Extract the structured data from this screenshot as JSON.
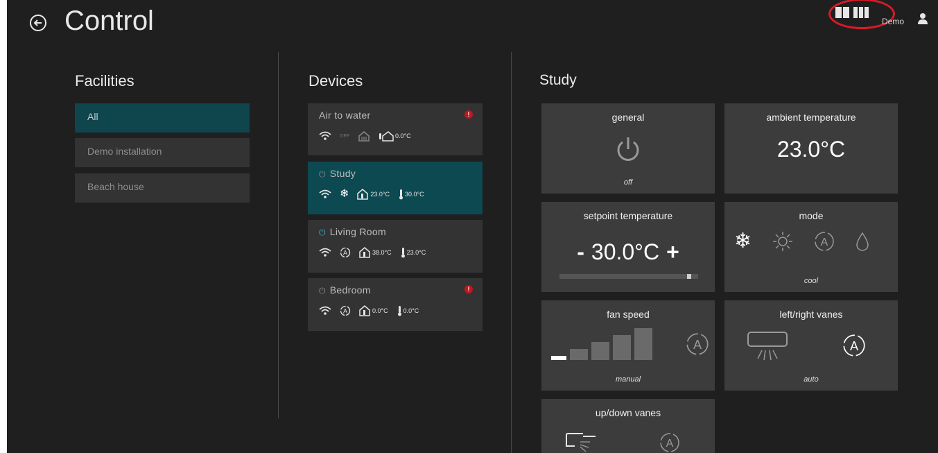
{
  "header": {
    "title": "Control",
    "user_name": "Demo"
  },
  "facilities": {
    "heading": "Facilities",
    "items": [
      {
        "label": "All",
        "active": true
      },
      {
        "label": "Demo installation"
      },
      {
        "label": "Beach house"
      }
    ]
  },
  "devices": {
    "heading": "Devices",
    "items": [
      {
        "name": "Air to water",
        "alert": "!",
        "status": "OFF",
        "outdoor_temp": "0.0°C"
      },
      {
        "name": "Study",
        "ambient": "23.0°C",
        "setpoint": "30.0°C"
      },
      {
        "name": "Living Room",
        "ambient": "38.0°C",
        "setpoint": "23.0°C"
      },
      {
        "name": "Bedroom",
        "alert": "!",
        "ambient": "0.0°C",
        "setpoint": "0.0°C"
      }
    ]
  },
  "study": {
    "heading": "Study",
    "general": {
      "title": "general",
      "state": "off"
    },
    "ambient": {
      "title": "ambient temperature",
      "value": "23.0°C"
    },
    "setpoint": {
      "title": "setpoint temperature",
      "minus": "-",
      "value": "30.0°C",
      "plus": "+",
      "level": 0.95
    },
    "mode": {
      "title": "mode",
      "value": "cool",
      "options": [
        "cool",
        "heat",
        "auto",
        "dry"
      ]
    },
    "fan": {
      "title": "fan speed",
      "value": "manual",
      "selected_level": 1,
      "levels": 5
    },
    "lr_vanes": {
      "title": "left/right vanes",
      "value": "auto"
    },
    "ud_vanes": {
      "title": "up/down vanes"
    }
  },
  "colors": {
    "background": "#1f1f20",
    "tile": "#3c3c3d",
    "active": "#0d4950",
    "alert": "#c0161f",
    "annotation": "#d81b25"
  }
}
